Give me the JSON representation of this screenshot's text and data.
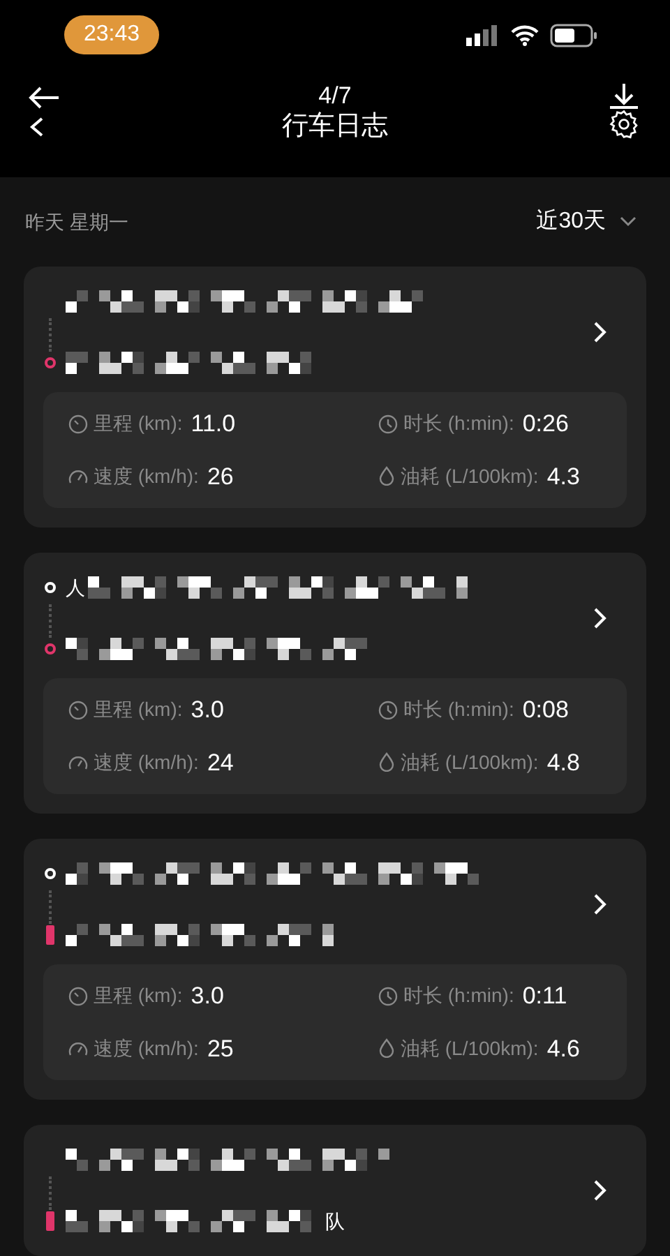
{
  "status_bar": {
    "time": "23:43"
  },
  "header": {
    "counter": "4/7",
    "title": "行车日志"
  },
  "filter": {
    "date": "昨天 星期一",
    "range": "近30天"
  },
  "trips": [
    {
      "end": {
        "kind": "ring"
      },
      "stats": [
        {
          "kind": "distance",
          "label": "里程 (km):",
          "value": "11.0"
        },
        {
          "kind": "duration",
          "label": "时长 (h:min):",
          "value": "0:26"
        },
        {
          "kind": "speed",
          "label": "速度 (km/h):",
          "value": "26"
        },
        {
          "kind": "fuel",
          "label": "油耗 (L/100km):",
          "value": "4.3"
        }
      ]
    },
    {
      "start": {
        "kind": "ring",
        "fragment": "人"
      },
      "end": {
        "kind": "ring"
      },
      "stats": [
        {
          "kind": "distance",
          "label": "里程 (km):",
          "value": "3.0"
        },
        {
          "kind": "duration",
          "label": "时长 (h:min):",
          "value": "0:08"
        },
        {
          "kind": "speed",
          "label": "速度 (km/h):",
          "value": "24"
        },
        {
          "kind": "fuel",
          "label": "油耗 (L/100km):",
          "value": "4.8"
        }
      ]
    },
    {
      "start": {
        "kind": "ring"
      },
      "end": {
        "kind": "bar"
      },
      "stats": [
        {
          "kind": "distance",
          "label": "里程 (km):",
          "value": "3.0"
        },
        {
          "kind": "duration",
          "label": "时长 (h:min):",
          "value": "0:11"
        },
        {
          "kind": "speed",
          "label": "速度 (km/h):",
          "value": "25"
        },
        {
          "kind": "fuel",
          "label": "油耗 (L/100km):",
          "value": "4.6"
        }
      ]
    },
    {
      "end": {
        "kind": "bar",
        "fragment": "队"
      }
    }
  ]
}
